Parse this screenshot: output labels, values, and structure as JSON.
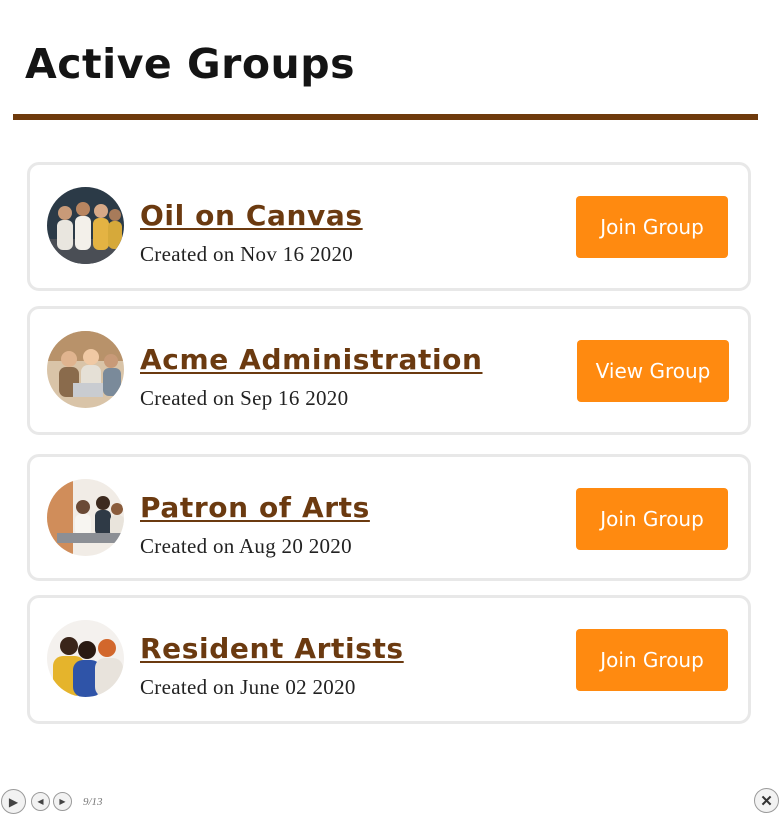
{
  "page": {
    "title": "Active Groups"
  },
  "groups": [
    {
      "name": "Oil on Canvas",
      "created": "Created on Nov 16 2020",
      "action": "Join Group",
      "avatar": "group-photo-icon"
    },
    {
      "name": "Acme Administration",
      "created": "Created on Sep 16 2020",
      "action": "View Group",
      "avatar": "group-photo-icon"
    },
    {
      "name": "Patron of Arts",
      "created": "Created on Aug 20 2020",
      "action": "Join Group",
      "avatar": "group-photo-icon"
    },
    {
      "name": "Resident Artists",
      "created": "Created on June 02 2020",
      "action": "Join Group",
      "avatar": "group-photo-icon"
    }
  ],
  "player": {
    "play_icon": "▶",
    "prev_icon": "◀",
    "next_icon": "▶",
    "slide_counter": "9/13",
    "close_icon": "✕"
  },
  "colors": {
    "accent": "#ff8a10",
    "rule": "#6e3a0c",
    "link": "#6b3a10"
  }
}
